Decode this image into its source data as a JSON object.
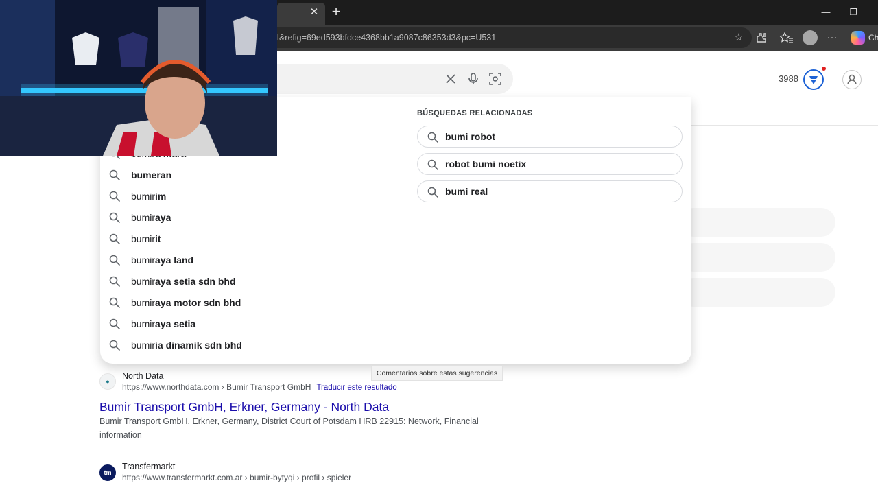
{
  "browser": {
    "tab_close_glyph": "✕",
    "new_tab_glyph": "+",
    "address_url": "1&refig=69ed593bfdce4368bb1a9087c86353d3&pc=U531",
    "copilot_label": "Ch",
    "icons": [
      "star-icon",
      "extensions-icon",
      "favorites-icon",
      "profile-icon",
      "more-icon",
      "copilot-icon"
    ],
    "window_controls": [
      "minimize-icon",
      "restore-icon"
    ]
  },
  "search": {
    "points": "3988"
  },
  "suggestions": {
    "items": [
      {
        "prefix": "bumir",
        "suffix": "a mara"
      },
      {
        "prefix": "",
        "suffix": "bumeran"
      },
      {
        "prefix": "bumir",
        "suffix": "im"
      },
      {
        "prefix": "bumir",
        "suffix": "aya"
      },
      {
        "prefix": "bumir",
        "suffix": "it"
      },
      {
        "prefix": "bumir",
        "suffix": "aya land"
      },
      {
        "prefix": "bumir",
        "suffix": "aya setia sdn bhd"
      },
      {
        "prefix": "bumir",
        "suffix": "aya motor sdn bhd"
      },
      {
        "prefix": "bumir",
        "suffix": "aya setia"
      },
      {
        "prefix": "bumir",
        "suffix": "ia dinamik sdn bhd"
      }
    ],
    "related_title": "BÚSQUEDAS RELACIONADAS",
    "related": [
      "bumi robot",
      "robot bumi noetix",
      "bumi real"
    ],
    "feedback": "Comentarios sobre estas sugerencias"
  },
  "results": [
    {
      "site": "North Data",
      "url": "https://www.northdata.com › Bumir Transport GmbH",
      "translate": "Traducir este resultado",
      "title": "Bumir Transport GmbH, Erkner, Germany - North Data",
      "snippet": "Bumir Transport GmbH, Erkner, Germany, District Court of Potsdam HRB 22915: Network, Financial information"
    },
    {
      "site": "Transfermarkt",
      "url": "https://www.transfermarkt.com.ar › bumir-bytyqi › profil › spieler"
    }
  ],
  "colors": {
    "link": "#1a0dab",
    "rewards": "#1e63d6",
    "chrome_dark": "#1c1c1c",
    "toolbar": "#3b3b3b"
  }
}
